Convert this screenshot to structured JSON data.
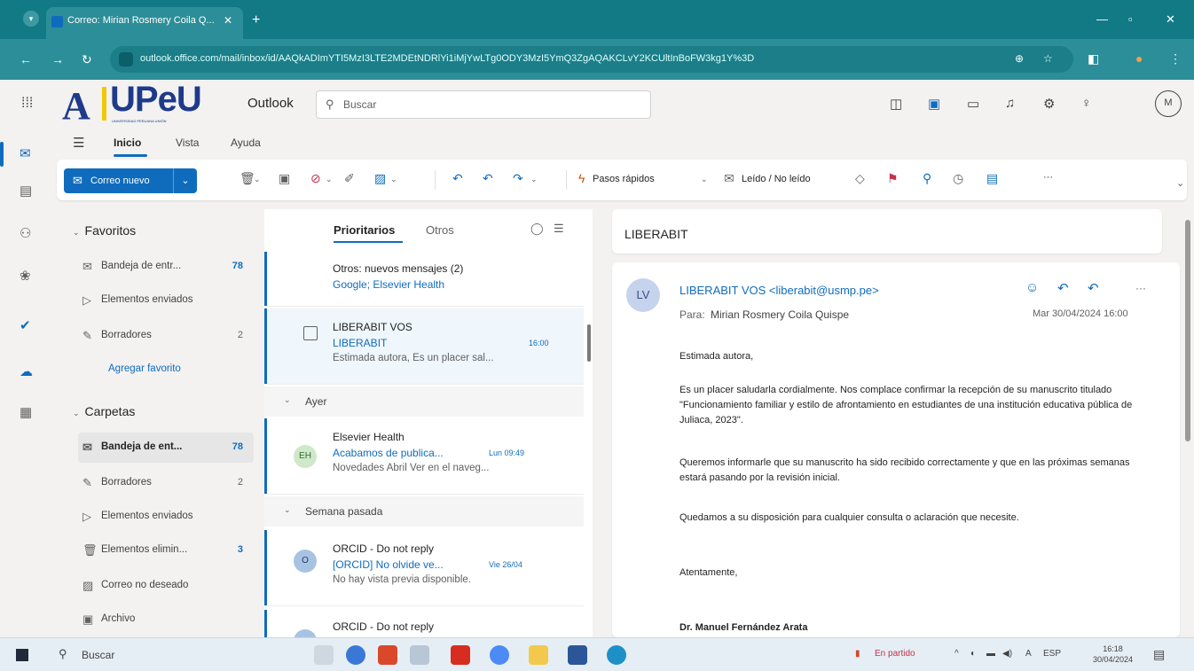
{
  "browser": {
    "tab_title": "Correo: Mirian Rosmery Coila Q...",
    "url": "outlook.office.com/mail/inbox/id/AAQkADImYTI5MzI3LTE2MDEtNDRlYi1iMjYwLTg0ODY3MzI5YmQ3ZgAQAKCLvY2KCUltInBoFW3kg1Y%3D",
    "tab_close": "✕",
    "tab_new": "+"
  },
  "header": {
    "logo_mark": "A",
    "logo_text": "UPeU",
    "logo_sub": "UNIVERSIDAD PERUANA UNIÓN",
    "app_name": "Outlook",
    "search_placeholder": "Buscar",
    "avatar_initial": "M"
  },
  "ribbon_tabs": [
    "Inicio",
    "Vista",
    "Ayuda"
  ],
  "ribbon": {
    "new_mail": "Correo nuevo",
    "quick_steps": "Pasos rápidos",
    "read_unread": "Leído / No leído",
    "more": "···"
  },
  "folders": {
    "favorites_title": "Favoritos",
    "favorites": [
      {
        "label": "Bandeja de entr...",
        "count": "78",
        "icon": "inbox-icon"
      },
      {
        "label": "Elementos enviados",
        "count": "",
        "icon": "send-icon"
      },
      {
        "label": "Borradores",
        "count": "2",
        "icon": "draft-icon"
      }
    ],
    "add_favorite": "Agregar favorito",
    "folders_title": "Carpetas",
    "items": [
      {
        "label": "Bandeja de ent...",
        "count": "78",
        "icon": "inbox-icon"
      },
      {
        "label": "Borradores",
        "count": "2",
        "icon": "draft-icon"
      },
      {
        "label": "Elementos enviados",
        "count": "",
        "icon": "send-icon"
      },
      {
        "label": "Elementos elimin...",
        "count": "3",
        "icon": "trash-icon"
      },
      {
        "label": "Correo no deseado",
        "count": "",
        "icon": "junk-icon"
      },
      {
        "label": "Archivo",
        "count": "",
        "icon": "archive-icon"
      }
    ]
  },
  "message_list": {
    "tab_focused": "Prioritarios",
    "tab_other": "Otros",
    "other_banner": {
      "title": "Otros: nuevos mensajes (2)",
      "senders": "Google; Elsevier Health"
    },
    "messages": [
      {
        "from": "LIBERABIT VOS",
        "subject": "LIBERABIT",
        "time": "16:00",
        "preview": "Estimada autora, Es un placer sal...",
        "avatar": ""
      },
      {
        "from": "Elsevier Health",
        "subject": "Acabamos de publica...",
        "time": "Lun 09:49",
        "preview": "Novedades Abril Ver en el naveg...",
        "avatar": "EH"
      },
      {
        "from": "ORCID - Do not reply",
        "subject": "[ORCID] No olvide ve...",
        "time": "Vie 26/04",
        "preview": "No hay vista previa disponible.",
        "avatar": "O"
      },
      {
        "from": "ORCID - Do not reply",
        "subject": "",
        "time": "",
        "preview": "",
        "avatar": ""
      }
    ],
    "group_yesterday": "Ayer",
    "group_last_week": "Semana pasada"
  },
  "reading_pane": {
    "title": "LIBERABIT",
    "avatar": "LV",
    "from": "LIBERABIT VOS <liberabit@usmp.pe>",
    "to_label": "Para:",
    "to": "Mirian Rosmery Coila Quispe",
    "date": "Mar 30/04/2024 16:00",
    "body": [
      "Estimada autora,",
      "Es un placer saludarla cordialmente. Nos complace confirmar la recepción de su manuscrito titulado \"Funcionamiento familiar y estilo de afrontamiento en estudiantes de una institución educativa pública de Juliaca, 2023\".",
      "Queremos informarle que su manuscrito ha sido recibido correctamente y que en las próximas semanas estará pasando por la revisión inicial.",
      "Quedamos a su disposición para cualquier consulta o aclaración que necesite.",
      "Atentamente,"
    ],
    "signature": "Dr. Manuel Fernández Arata"
  },
  "taskbar": {
    "search": "Buscar",
    "weather": "En partido",
    "lang": "ESP",
    "time": "16:18",
    "date": "30/04/2024"
  },
  "colors": {
    "accent": "#0f6cbd",
    "browser": "#127a85"
  }
}
